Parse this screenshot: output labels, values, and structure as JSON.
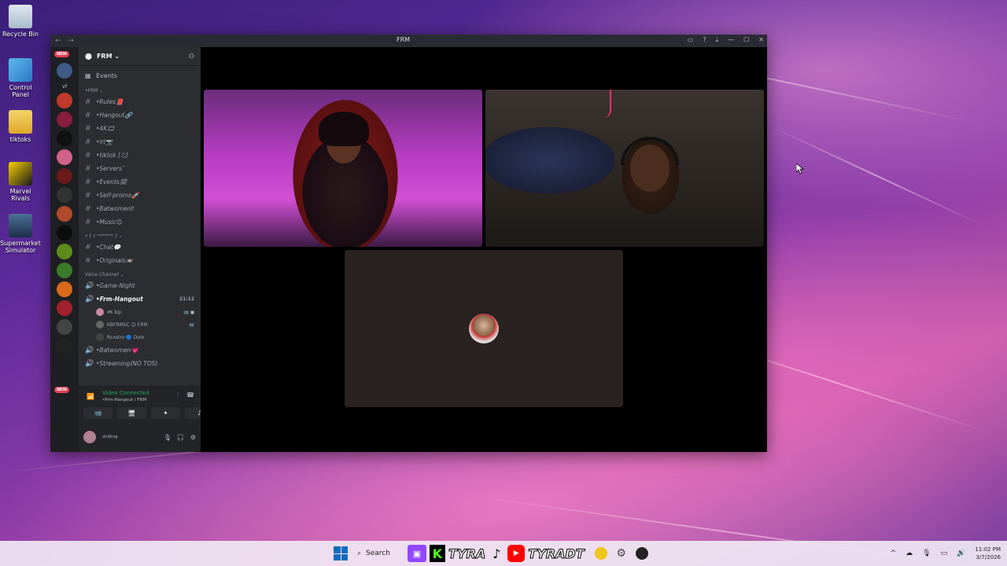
{
  "desktop": {
    "icons": [
      {
        "label": "Recycle Bin",
        "icon": "recycle-bin-icon"
      },
      {
        "label": "Control Panel",
        "icon": "control-panel-icon"
      },
      {
        "label": "tiktoks",
        "icon": "folder-icon"
      },
      {
        "label": "Marvel Rivals",
        "icon": "marvel-rivals-icon"
      },
      {
        "label": "Supermarket Simulator",
        "icon": "supermarket-simulator-icon"
      }
    ]
  },
  "window": {
    "title": "FRM",
    "back": "←",
    "forward": "→",
    "controls": [
      "▭",
      "?",
      "⤓",
      "—",
      "☐",
      "✕"
    ]
  },
  "server_list": {
    "new_badge": "NEW",
    "folder_label": "vf",
    "new_badge_bottom": "NEW"
  },
  "guild": {
    "name": "FRM ⌄",
    "events_label": "Events",
    "category_frm": "•FRM ⌄",
    "text_channels": [
      "•Rules📕",
      "•Hangout🔗",
      "•4K🎞",
      "•irl📷",
      "•tiktok [♫]",
      "•Servers˜",
      "•Events🗓",
      "•Self-promo🚀",
      "•Batwomen‼",
      "•Music😊"
    ],
    "category_second": "• [ √ ⁿᵉʷˢˡᵉᵗᵗᵉʳ ] ⌄",
    "text_channels_2": [
      "•Chat💬",
      "•Originals📼"
    ],
    "voice_category": "Voice Channel ⌄",
    "voice_channels": [
      {
        "name": "•Game-Night",
        "active": false,
        "time": ""
      },
      {
        "name": "•Frm-Hangout",
        "active": true,
        "time": "21:12"
      }
    ],
    "members": [
      {
        "name": "🎮 bip",
        "icons": "📹 ◼"
      },
      {
        "name": "KBFRMSC 😊 FRM",
        "icons": "📹"
      },
      {
        "name": "Rcxstro 🔵 Dolo",
        "icons": ""
      }
    ],
    "voice_channels_2": [
      "•Batwomen💗",
      "•Streaming(NO TOS)"
    ]
  },
  "voice_connection": {
    "status": "Video Connected",
    "channel": "•Frm-Hangout / FRM"
  },
  "controls": {
    "video": "📹",
    "screen": "🖥",
    "activity": "✦",
    "soundboard": "♪"
  },
  "user": {
    "status_text": "shilling"
  },
  "taskbar": {
    "search_label": "Search",
    "kick_label": "K",
    "name1": "TYRA",
    "name2": "TYRADT",
    "time": "11:02 PM",
    "date": "3/7/2026"
  },
  "colors": {
    "discord_dark": "#1e1f22",
    "discord_sidebar": "#2b2d31",
    "connected_green": "#23a55a",
    "twitch_purple": "#9146ff",
    "kick_green": "#53fc18",
    "youtube_red": "#ff0000"
  }
}
